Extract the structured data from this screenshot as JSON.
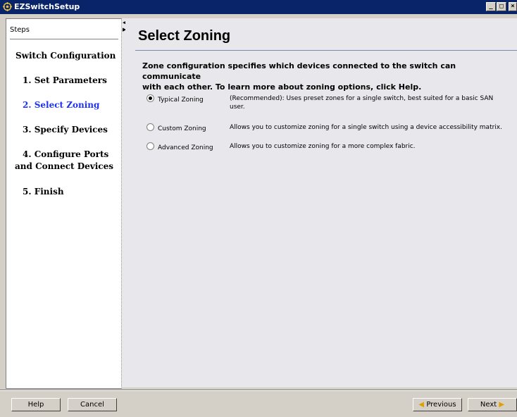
{
  "window": {
    "title": "EZSwitchSetup"
  },
  "sidebar": {
    "header": "Steps",
    "items": [
      {
        "label": "Switch Configuration"
      },
      {
        "label": "1. Set Parameters"
      },
      {
        "label": "2. Select Zoning",
        "active": true
      },
      {
        "label": "3. Specify Devices"
      },
      {
        "label": "4. Configure Ports",
        "label2": "and Connect Devices"
      },
      {
        "label": "5. Finish"
      }
    ]
  },
  "main": {
    "title": "Select Zoning",
    "intro_line1": "Zone configuration specifies which devices connected to the switch can communicate",
    "intro_line2": "with each other. To learn more about zoning options, click Help.",
    "options": [
      {
        "label": "Typical Zoning",
        "selected": true,
        "desc1": "(Recommended): Uses preset zones for a single switch, best suited for a basic SAN",
        "desc2": "user."
      },
      {
        "label": "Custom Zoning",
        "selected": false,
        "desc1": "Allows you to customize zoning for a single switch using a device accessibility matrix."
      },
      {
        "label": "Advanced Zoning",
        "selected": false,
        "desc1": "Allows you to customize zoning for a more complex fabric."
      }
    ]
  },
  "footer": {
    "help_label": "Help",
    "cancel_label": "Cancel",
    "previous_label": "Previous",
    "next_label": "Next"
  },
  "colors": {
    "titlebar": "#0a246a",
    "active_step": "#1e32f0",
    "arrow": "#e0a000"
  }
}
